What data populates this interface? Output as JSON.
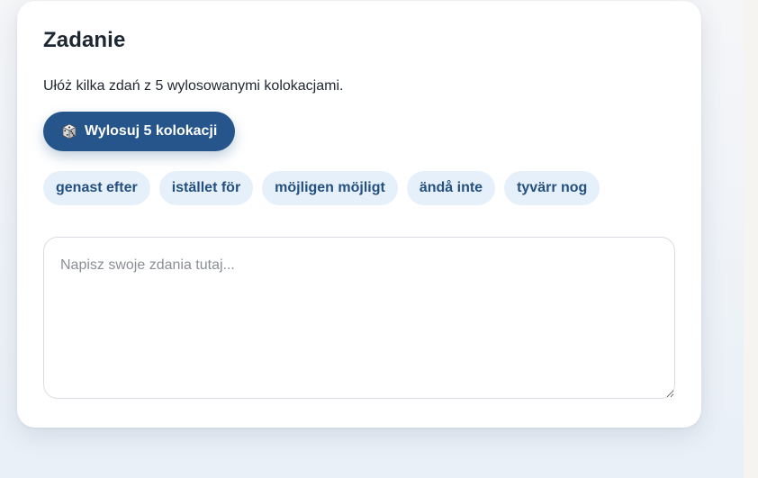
{
  "task": {
    "title": "Zadanie",
    "instruction": "Ułóż kilka zdań z 5 wylosowanymi kolokacjami.",
    "draw_button": {
      "icon": "die-icon",
      "label": "Wylosuj 5 kolokacji"
    },
    "collocations": [
      "genast efter",
      "istället för",
      "möjligen möjligt",
      "ändå inte",
      "tyvärr nog"
    ],
    "answer_placeholder": "Napisz swoje zdania tutaj...",
    "answer_value": ""
  },
  "colors": {
    "accent": "#25558a",
    "chip_bg": "#e6f0fb",
    "chip_text": "#24507f",
    "title_text": "#1d2733"
  }
}
